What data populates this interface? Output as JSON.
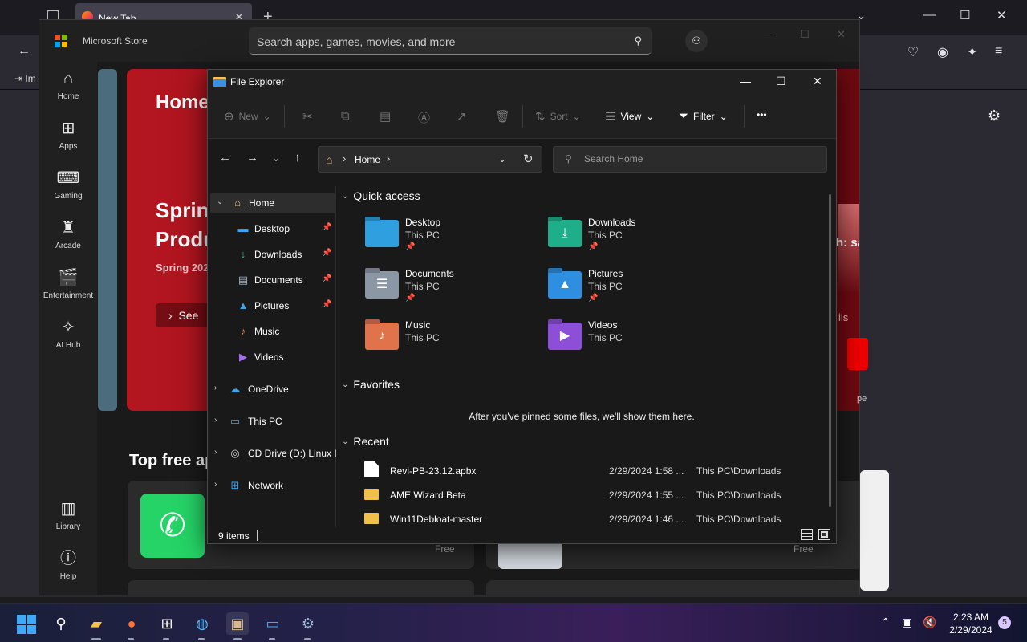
{
  "firefox": {
    "tab_title": "New Tab",
    "import_label": "Im"
  },
  "store": {
    "app_name": "Microsoft Store",
    "search_placeholder": "Search apps, games, movies, and more",
    "nav": [
      {
        "label": "Home",
        "icon": "home-icon"
      },
      {
        "label": "Apps",
        "icon": "apps-icon"
      },
      {
        "label": "Gaming",
        "icon": "gaming-icon"
      },
      {
        "label": "Arcade",
        "icon": "arcade-icon"
      },
      {
        "label": "Entertainment",
        "icon": "entertainment-icon"
      },
      {
        "label": "AI Hub",
        "icon": "ai-hub-icon"
      },
      {
        "label": "Library",
        "icon": "library-icon"
      },
      {
        "label": "Help",
        "icon": "help-icon"
      }
    ],
    "hero": {
      "title": "Home",
      "headline_line1": "Sprin",
      "headline_line2": "Produ",
      "subtitle": "Spring 202",
      "button": "See",
      "right_text": "h: sa",
      "right_sub": "ils"
    },
    "section_title": "Top free ap",
    "side_label": "pe",
    "price_1": "Free",
    "price_2": "Free"
  },
  "explorer": {
    "window_title": "File Explorer",
    "toolbar": {
      "new": "New",
      "sort": "Sort",
      "view": "View",
      "filter": "Filter",
      "more": "•••"
    },
    "address": {
      "location": "Home",
      "search_placeholder": "Search Home"
    },
    "tree": {
      "home": "Home",
      "pinned": [
        {
          "label": "Desktop",
          "icon": "desktop-icon",
          "pinned": true
        },
        {
          "label": "Downloads",
          "icon": "downloads-icon",
          "pinned": true
        },
        {
          "label": "Documents",
          "icon": "documents-icon",
          "pinned": true
        },
        {
          "label": "Pictures",
          "icon": "pictures-icon",
          "pinned": true
        },
        {
          "label": "Music",
          "icon": "music-icon",
          "pinned": false
        },
        {
          "label": "Videos",
          "icon": "videos-icon",
          "pinned": false
        }
      ],
      "roots": [
        {
          "label": "OneDrive",
          "icon": "onedrive-icon"
        },
        {
          "label": "This PC",
          "icon": "this-pc-icon"
        },
        {
          "label": "CD Drive (D:) Linux I",
          "icon": "cd-drive-icon"
        },
        {
          "label": "Network",
          "icon": "network-icon"
        }
      ]
    },
    "sections": {
      "quick_access": "Quick access",
      "favorites": "Favorites",
      "recent": "Recent"
    },
    "quick_access": [
      {
        "name": "Desktop",
        "location": "This PC",
        "pinned": true,
        "color": "#2f9fe0"
      },
      {
        "name": "Downloads",
        "location": "This PC",
        "pinned": true,
        "color": "#1fae8a"
      },
      {
        "name": "Documents",
        "location": "This PC",
        "pinned": true,
        "color": "#8c97a6"
      },
      {
        "name": "Pictures",
        "location": "This PC",
        "pinned": true,
        "color": "#2e8fe0"
      },
      {
        "name": "Music",
        "location": "This PC",
        "pinned": false,
        "color": "#e0734a"
      },
      {
        "name": "Videos",
        "location": "This PC",
        "pinned": false,
        "color": "#8d4fd8"
      }
    ],
    "favorites_message": "After you've pinned some files, we'll show them here.",
    "recent": [
      {
        "name": "Revi-PB-23.12.apbx",
        "date": "2/29/2024 1:58 ...",
        "path": "This PC\\Downloads",
        "type": "file"
      },
      {
        "name": "AME Wizard Beta",
        "date": "2/29/2024 1:55 ...",
        "path": "This PC\\Downloads",
        "type": "folder"
      },
      {
        "name": "Win11Debloat-master",
        "date": "2/29/2024 1:46 ...",
        "path": "This PC\\Downloads",
        "type": "folder"
      }
    ],
    "status": {
      "item_count": "9 items"
    }
  },
  "taskbar": {
    "time": "2:23 AM",
    "date": "2/29/2024",
    "notification_count": "5"
  }
}
